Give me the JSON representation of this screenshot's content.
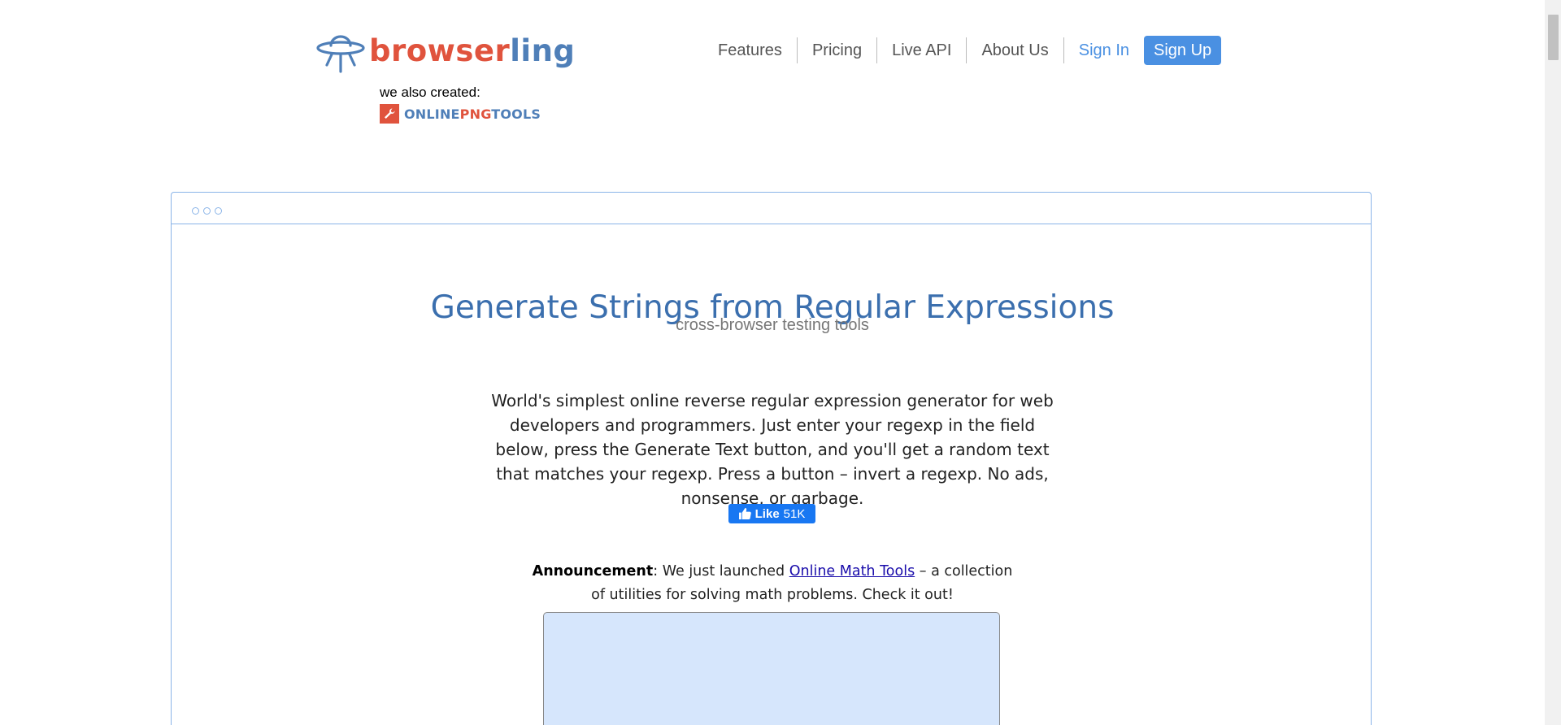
{
  "header": {
    "logo_part1": "browser",
    "logo_part2": "ling",
    "also_created": "we also created:",
    "partner": {
      "part1": "ONLINE",
      "part2": "PNG",
      "part3": "TOOLS"
    }
  },
  "nav": {
    "features": "Features",
    "pricing": "Pricing",
    "live_api": "Live API",
    "about": "About Us",
    "sign_in": "Sign In",
    "sign_up": "Sign Up"
  },
  "main": {
    "title": "Generate Strings from Regular Expressions",
    "subtitle": "cross-browser testing tools",
    "description": "World's simplest online reverse regular expression generator for web developers and programmers. Just enter your regexp in the field below, press the Generate Text button, and you'll get a random text that matches your regexp. Press a button – invert a regexp. No ads, nonsense, or garbage.",
    "like_label": "Like",
    "like_count": "51K",
    "announcement_label": "Announcement",
    "announcement_pre": ": We just launched ",
    "announcement_link": "Online Math Tools",
    "announcement_post": " – a collection of utilities for solving math problems. Check it out!",
    "regex_input_value": ""
  },
  "colors": {
    "brand_red": "#e0533d",
    "brand_blue": "#4f7fb8",
    "accent": "#4a90e2",
    "input_bg": "#d6e6fc"
  }
}
